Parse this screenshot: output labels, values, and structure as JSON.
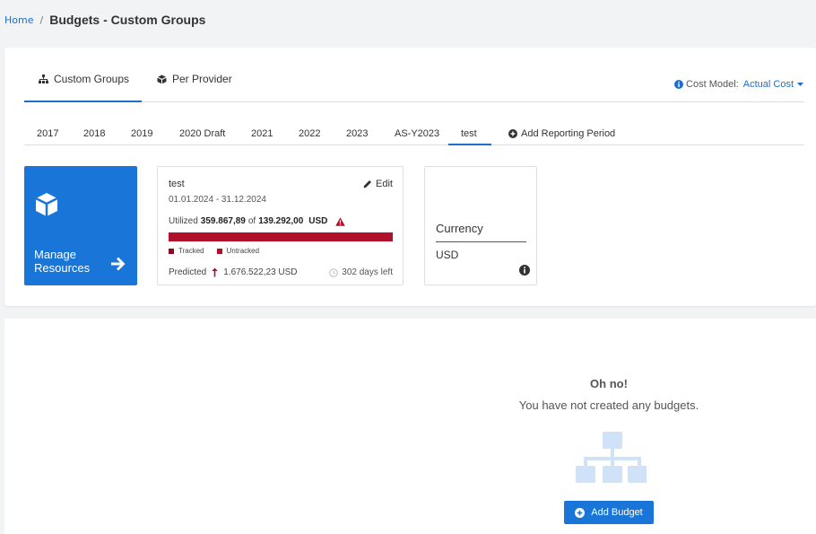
{
  "breadcrumb": {
    "home": "Home",
    "separator": "/",
    "title": "Budgets - Custom Groups"
  },
  "main_tabs": [
    {
      "label": "Custom Groups",
      "icon": "sitemap-icon",
      "active": true
    },
    {
      "label": "Per Provider",
      "icon": "cube-icon",
      "active": false
    }
  ],
  "cost_model": {
    "label": "Cost Model:",
    "value": "Actual Cost"
  },
  "period_tabs": [
    "2017",
    "2018",
    "2019",
    "2020 Draft",
    "2021",
    "2022",
    "2023",
    "AS-Y2023",
    "test"
  ],
  "active_period": "test",
  "add_period_label": "Add Reporting Period",
  "manage_resources": {
    "label": "Manage Resources"
  },
  "budget_card": {
    "name": "test",
    "edit_label": "Edit",
    "dates": "01.01.2024 - 31.12.2024",
    "utilized_label": "Utilized",
    "utilized_value": "359.867,89",
    "of_label": "of",
    "total_value": "139.292,00",
    "currency": "USD",
    "utilization_fraction": 1.0,
    "legend_tracked": "Tracked",
    "legend_untracked": "Untracked",
    "predicted_label": "Predicted",
    "predicted_value": "1.676.522,23 USD",
    "days_left": "302 days left",
    "colors": {
      "tracked": "#8b0a20",
      "untracked": "#b0102a",
      "bar": "#b0102a"
    }
  },
  "currency_card": {
    "label": "Currency",
    "value": "USD"
  },
  "empty_state": {
    "title": "Oh no!",
    "message": "You have not created any budgets.",
    "button_label": "Add Budget"
  },
  "colors": {
    "accent": "#1a75d8",
    "link": "#1a6fd1"
  }
}
